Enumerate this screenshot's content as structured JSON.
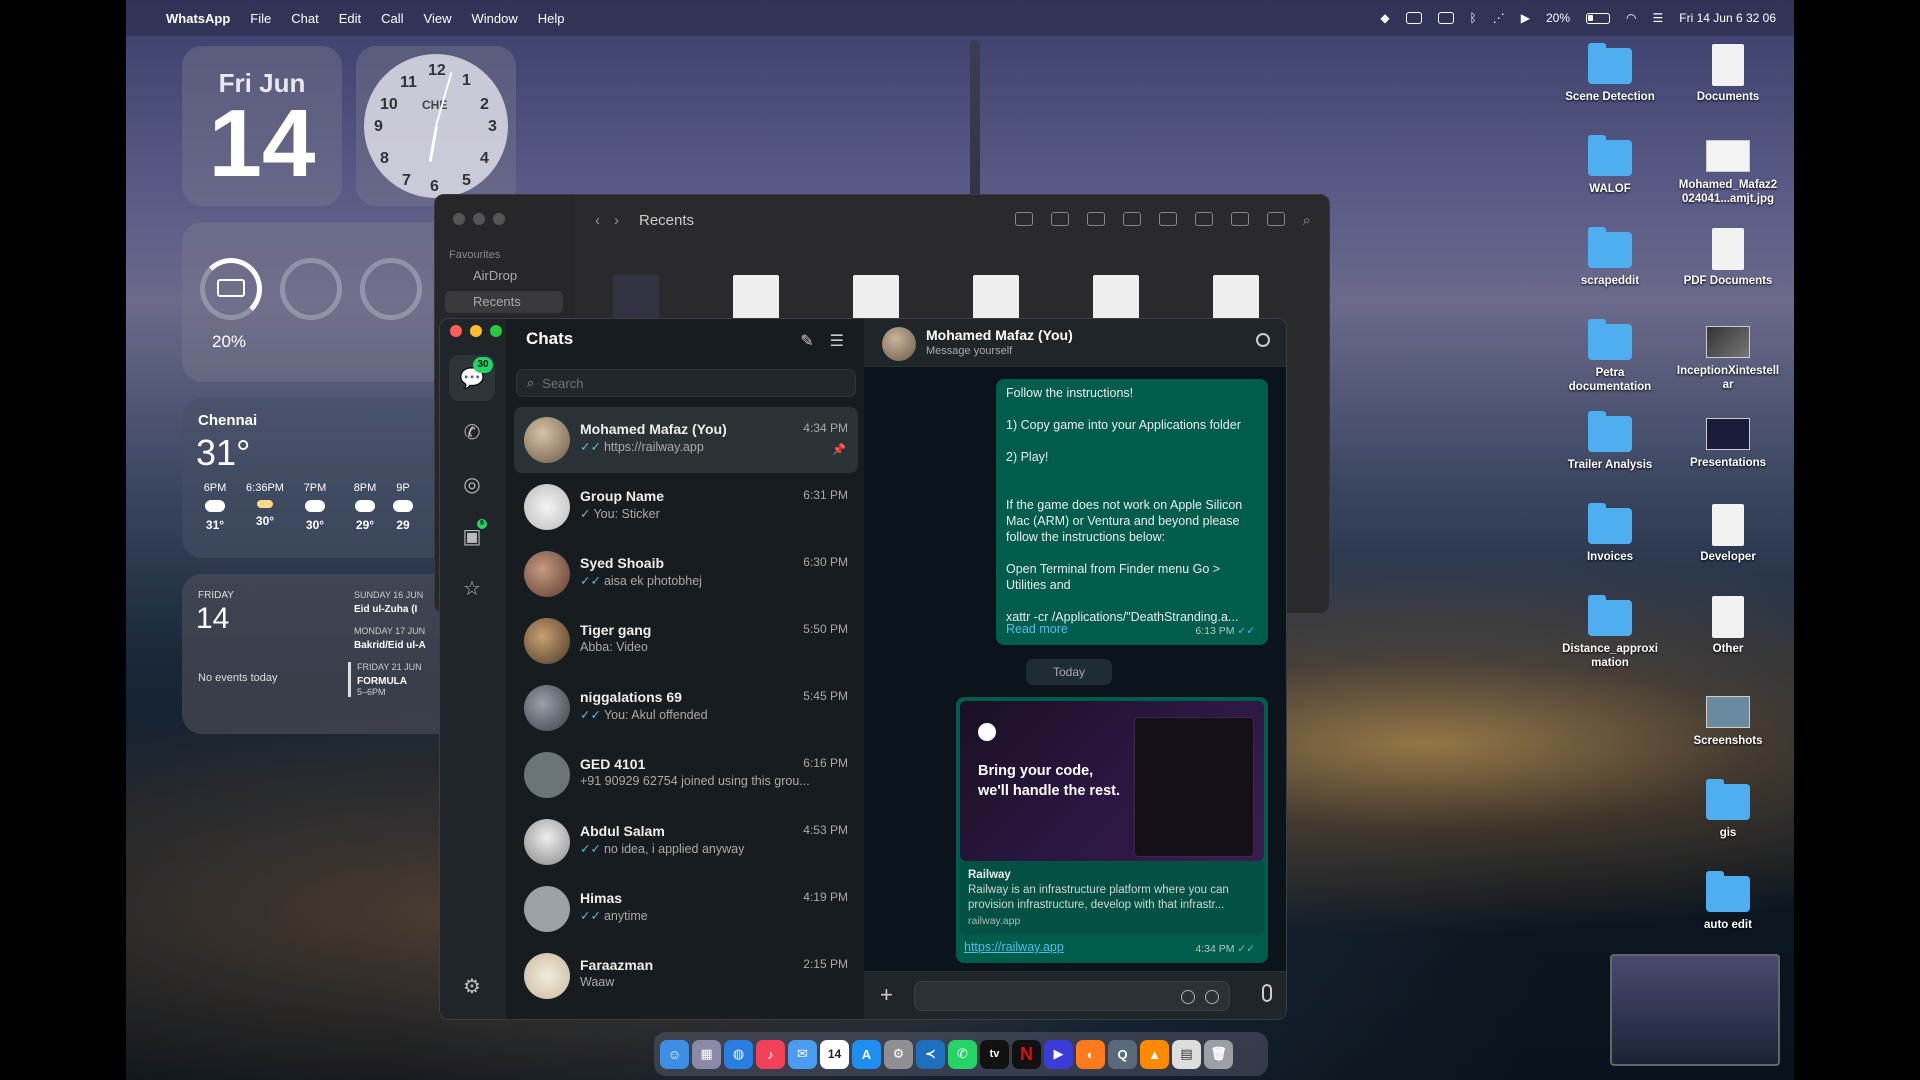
{
  "menubar": {
    "app": "WhatsApp",
    "items": [
      "File",
      "Chat",
      "Edit",
      "Call",
      "View",
      "Window",
      "Help"
    ],
    "battery_pct": "20%",
    "datetime": "Fri 14 Jun  6 32 06"
  },
  "widgets": {
    "date": {
      "weekday_month": "Fri Jun",
      "day": "14"
    },
    "clock": {
      "label": "CHE",
      "numbers": [
        "12",
        "1",
        "2",
        "3",
        "4",
        "5",
        "6",
        "7",
        "8",
        "9",
        "10",
        "11"
      ]
    },
    "battery": {
      "pct": "20%"
    },
    "weather": {
      "city": "Chennai",
      "temp": "31°",
      "hours": [
        {
          "time": "6PM",
          "t": "31°"
        },
        {
          "time": "6:36PM",
          "t": "30°"
        },
        {
          "time": "7PM",
          "t": "30°"
        },
        {
          "time": "8PM",
          "t": "29°"
        },
        {
          "time": "9P",
          "t": "29"
        }
      ]
    },
    "calendar": {
      "weekday": "FRIDAY",
      "day": "14",
      "no_events": "No events today",
      "events": [
        {
          "date": "SUNDAY 16 JUN",
          "title": "Eid ul-Zuha (I"
        },
        {
          "date": "MONDAY 17 JUN",
          "title": "Bakrid/Eid ul-A"
        },
        {
          "date": "FRIDAY 21 JUN",
          "title": "FORMULA",
          "time": "5–6PM"
        }
      ]
    }
  },
  "finder": {
    "title": "Recents",
    "favourites_label": "Favourites",
    "sidebar": [
      "AirDrop",
      "Recents"
    ]
  },
  "whatsapp": {
    "title": "Chats",
    "unread_badge": "30",
    "updates_badge": "9",
    "search_placeholder": "Search",
    "chats": [
      {
        "name": "Mohamed Mafaz (You)",
        "preview": "https://railway.app",
        "time": "4:34 PM",
        "tick": true,
        "pinned": true
      },
      {
        "name": "Group Name",
        "preview": "You: Sticker",
        "time": "6:31 PM",
        "tick": true
      },
      {
        "name": "Syed Shoaib",
        "preview": "aisa ek photobhej",
        "time": "6:30 PM",
        "tick": true
      },
      {
        "name": "Tiger gang",
        "preview": "Abba: Video",
        "time": "5:50 PM"
      },
      {
        "name": "niggalations 69",
        "preview": "You: Akul offended",
        "time": "5:45 PM",
        "tick": true
      },
      {
        "name": "GED 4101",
        "preview": "+91 90929 62754 joined using this grou...",
        "time": "6:16 PM"
      },
      {
        "name": "Abdul Salam",
        "preview": "no idea, i applied anyway",
        "time": "4:53 PM",
        "tick": true
      },
      {
        "name": "Himas",
        "preview": "anytime",
        "time": "4:19 PM",
        "tick": true
      },
      {
        "name": "Faraazman",
        "preview": "Waaw",
        "time": "2:15 PM"
      }
    ],
    "conversation": {
      "name": "Mohamed Mafaz (You)",
      "subtitle": "Message yourself",
      "message1": {
        "text": "Follow the instructions!\n\n1) Copy game into your Applications folder\n\n2) Play!\n\n\nIf the game does not work on Apple Silicon Mac (ARM) or Ventura and beyond please follow the instructions below:\n\nOpen Terminal from Finder menu Go > Utilities and\n\nxattr -cr /Applications/\"DeathStranding.a...",
        "read_more": "Read more",
        "time": "6:13 PM"
      },
      "date_divider": "Today",
      "message2": {
        "tagline": "Bring your code, we'll handle the rest.",
        "link_title": "Railway",
        "link_desc": "Railway is an infrastructure platform where you can provision infrastructure, develop with that infrastr...",
        "link_domain": "railway.app",
        "url": "https://railway.app",
        "time": "4:34 PM"
      }
    }
  },
  "desktop_icons": [
    {
      "label": "Scene Detection",
      "type": "folder"
    },
    {
      "label": "Documents",
      "type": "doc"
    },
    {
      "label": "WALOF",
      "type": "folder"
    },
    {
      "label": "Mohamed_Mafaz2 024041...amjt.jpg",
      "type": "image"
    },
    {
      "label": "scrapeddit",
      "type": "folder"
    },
    {
      "label": "PDF Documents",
      "type": "doc"
    },
    {
      "label": "Petra documentation",
      "type": "folder"
    },
    {
      "label": "InceptionXintestell ar",
      "type": "image"
    },
    {
      "label": "Trailer Analysis",
      "type": "folder"
    },
    {
      "label": "Presentations",
      "type": "image"
    },
    {
      "label": "Invoices",
      "type": "folder"
    },
    {
      "label": "Developer",
      "type": "doc"
    },
    {
      "label": "Distance_approxi mation",
      "type": "folder"
    },
    {
      "label": "Other",
      "type": "doc"
    },
    {
      "label": "Screenshots",
      "type": "image"
    },
    {
      "label": "gis",
      "type": "folder"
    },
    {
      "label": "auto edit",
      "type": "folder"
    }
  ],
  "dock": {
    "calendar_day": "14",
    "apps": [
      "finder",
      "launchpad",
      "safari",
      "music",
      "mail",
      "calendar",
      "app-store",
      "settings",
      "vscode",
      "whatsapp",
      "tv",
      "netflix",
      "prime",
      "firefox",
      "quicktime",
      "vlc",
      "preview",
      "trash"
    ],
    "tv_label": "tv"
  }
}
